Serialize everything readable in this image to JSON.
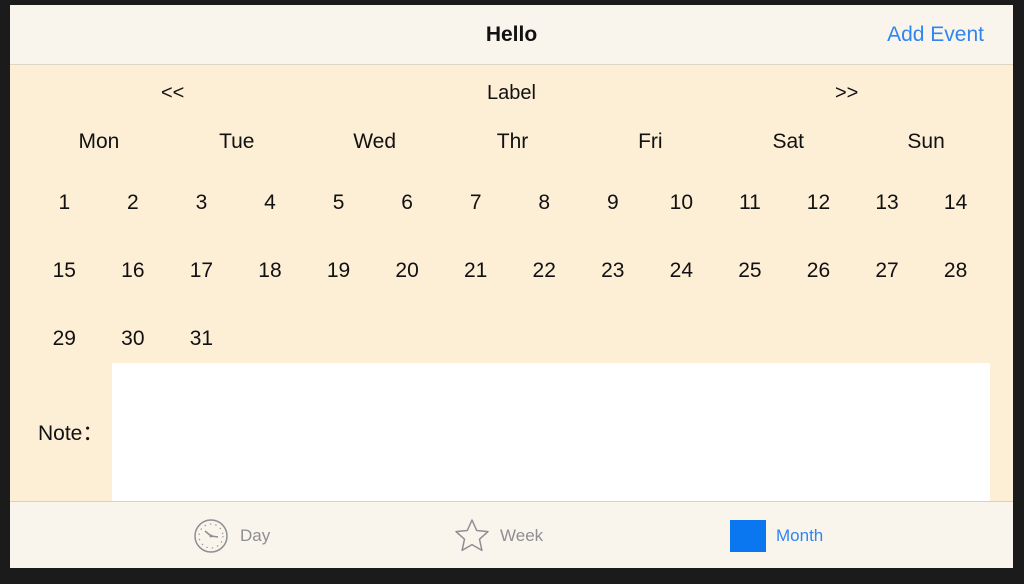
{
  "navbar": {
    "title": "Hello",
    "add_event_label": "Add Event"
  },
  "month_nav": {
    "prev": "<<",
    "label": "Label",
    "next": ">>"
  },
  "weekdays": [
    "Mon",
    "Tue",
    "Wed",
    "Thr",
    "Fri",
    "Sat",
    "Sun"
  ],
  "days": [
    "1",
    "2",
    "3",
    "4",
    "5",
    "6",
    "7",
    "8",
    "9",
    "10",
    "11",
    "12",
    "13",
    "14",
    "15",
    "16",
    "17",
    "18",
    "19",
    "20",
    "21",
    "22",
    "23",
    "24",
    "25",
    "26",
    "27",
    "28",
    "29",
    "30",
    "31"
  ],
  "note": {
    "label": "Note：",
    "value": ""
  },
  "tabs": [
    {
      "label": "Day",
      "icon": "clock-icon",
      "active": false
    },
    {
      "label": "Week",
      "icon": "star-icon",
      "active": false
    },
    {
      "label": "Month",
      "icon": "square-icon",
      "active": true
    }
  ],
  "colors": {
    "accent": "#2f86ee",
    "calendar_bg": "#fdeed6",
    "bar_bg": "#f9f5ec",
    "month_icon": "#0a77f0"
  }
}
